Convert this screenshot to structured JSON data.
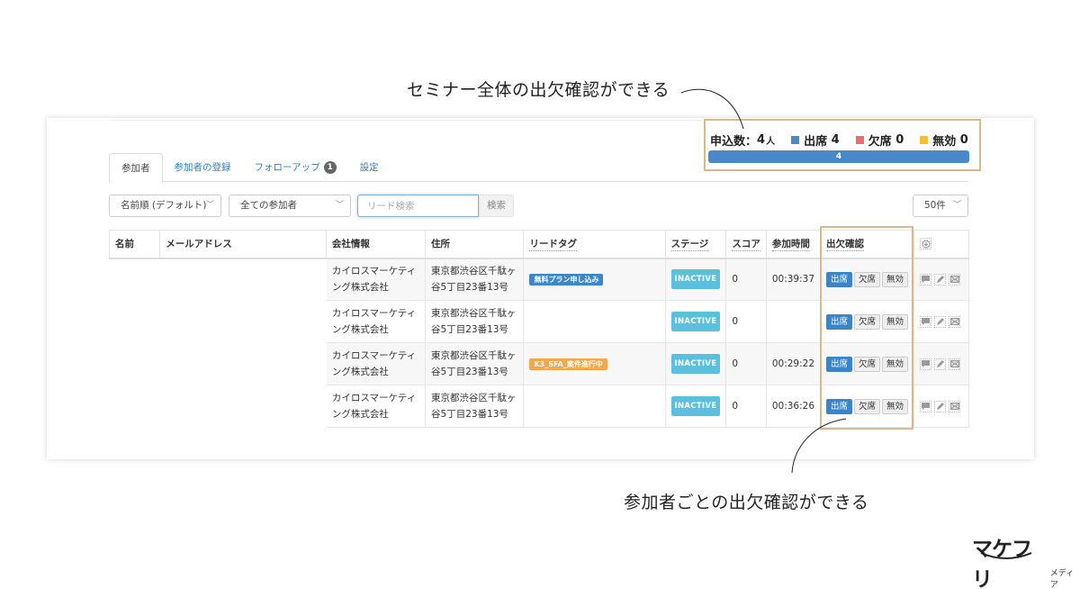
{
  "annotations": {
    "top": "セミナー全体の出欠確認ができる",
    "bottom": "参加者ごとの出欠確認ができる"
  },
  "summary": {
    "applications_label": "申込数：",
    "applications_count": "4",
    "applications_unit": "人",
    "legend": [
      {
        "label": "出席",
        "count": "4",
        "color": "#4a88ca"
      },
      {
        "label": "欠席",
        "count": "0",
        "color": "#ef6b6b"
      },
      {
        "label": "無効",
        "count": "0",
        "color": "#f5c02e"
      }
    ],
    "progress_label": "4",
    "progress_fraction": 1.0
  },
  "tabs": [
    {
      "label": "参加者",
      "active": true
    },
    {
      "label": "参加者の登録",
      "active": false
    },
    {
      "label": "フォローアップ",
      "active": false,
      "badge": "1"
    },
    {
      "label": "設定",
      "active": false
    }
  ],
  "filters": {
    "sort_value": "名前順 (デフォルト)",
    "participant_filter_value": "全ての参加者",
    "search_placeholder": "リード検索",
    "search_value": "",
    "search_button": "検索",
    "per_page_value": "50件"
  },
  "table": {
    "headers": [
      "名前",
      "メールアドレス",
      "会社情報",
      "住所",
      "リードタグ",
      "ステージ",
      "スコア",
      "参加時間",
      "出欠確認"
    ],
    "attendance_buttons": [
      "出席",
      "欠席",
      "無効"
    ],
    "rows": [
      {
        "name": "",
        "email": "",
        "company": "カイロスマーケティング株式会社",
        "address": "東京都渋谷区千駄ヶ谷5丁目23番13号",
        "tag": "無料プラン申し込み",
        "tag_color": "#3f86c8",
        "stage": "INACTIVE",
        "score": "0",
        "time": "00:39:37",
        "attendance": "出席"
      },
      {
        "name": "",
        "email": "",
        "company": "カイロスマーケティング株式会社",
        "address": "東京都渋谷区千駄ヶ谷5丁目23番13号",
        "tag": "",
        "tag_color": "",
        "stage": "INACTIVE",
        "score": "0",
        "time": "",
        "attendance": "出席"
      },
      {
        "name": "",
        "email": "",
        "company": "カイロスマーケティング株式会社",
        "address": "東京都渋谷区千駄ヶ谷5丁目23番13号",
        "tag": "K3_SFA_案件進行中",
        "tag_color": "#f0a94a",
        "stage": "INACTIVE",
        "score": "0",
        "time": "00:29:22",
        "attendance": "出席"
      },
      {
        "name": "",
        "email": "",
        "company": "カイロスマーケティング株式会社",
        "address": "東京都渋谷区千駄ヶ谷5丁目23番13号",
        "tag": "",
        "tag_color": "",
        "stage": "INACTIVE",
        "score": "0",
        "time": "00:36:26",
        "attendance": "出席"
      }
    ]
  },
  "logo": {
    "main": "マケフリ",
    "sub": "メディア"
  }
}
